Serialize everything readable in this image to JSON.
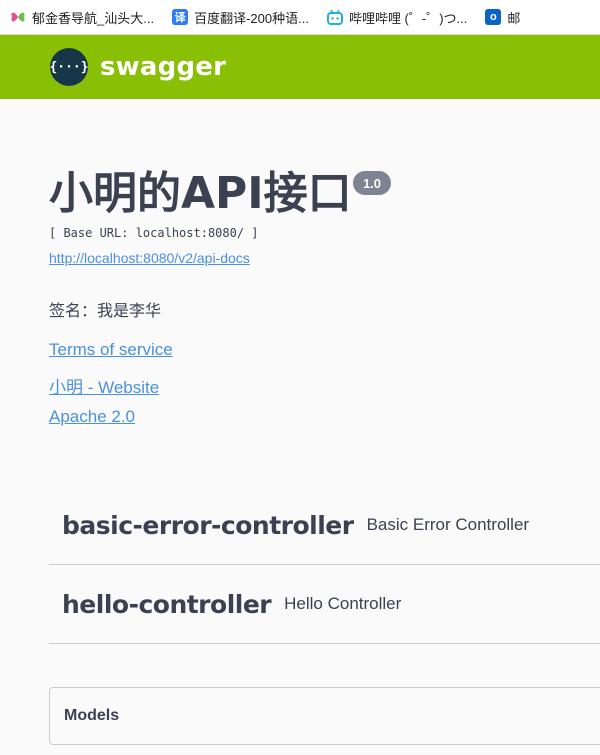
{
  "bookmarks": [
    {
      "label": "郁金香导航_汕头大...",
      "icon": "butterfly-icon",
      "color": "#e8508f"
    },
    {
      "label": "百度翻译-200种语...",
      "icon": "translate-icon",
      "color": "#2b7cf6"
    },
    {
      "label": "哔哩哔哩 (゜-゜)つ...",
      "icon": "bilibili-icon",
      "color": "#23ade5"
    },
    {
      "label": "邮",
      "icon": "outlook-icon",
      "color": "#0a64c8"
    }
  ],
  "header": {
    "logo_glyph": "{···}",
    "title": "swagger",
    "bg_color": "#89bf04"
  },
  "info": {
    "title": "小明的API接口",
    "version": "1.0",
    "base_url": "[ Base URL: localhost:8080/ ]",
    "api_docs_link": "http://localhost:8080/v2/api-docs",
    "description": "签名：我是李华",
    "links": [
      "Terms of service",
      "小明 - Website",
      "Apache 2.0"
    ],
    "link_color": "#4990e2"
  },
  "tags": [
    {
      "name": "basic-error-controller",
      "description": "Basic Error Controller"
    },
    {
      "name": "hello-controller",
      "description": "Hello Controller"
    }
  ],
  "models": {
    "title": "Models"
  }
}
